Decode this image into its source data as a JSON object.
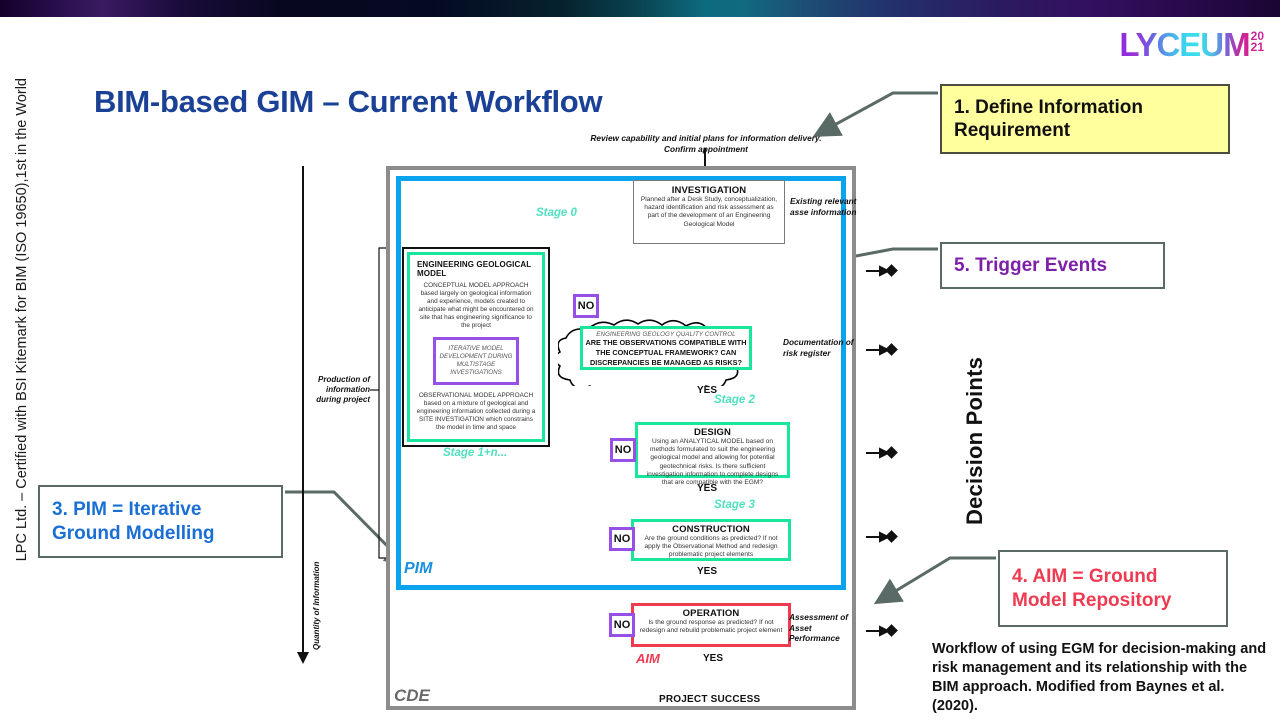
{
  "header": {
    "logo_word": "LYCEUM",
    "logo_year_top": "20",
    "logo_year_bottom": "21",
    "title": "BIM-based GIM – Current Workflow",
    "side_vertical_text": "LPC Ltd. – Certified with BSI Kitemark for BIM (ISO 19650),1st in the World"
  },
  "callouts": {
    "define": "1. Define Information Requirement",
    "trigger": "5. Trigger Events",
    "pim": "3. PIM = Iterative Ground Modelling",
    "aim": "4. AIM = Ground Model Repository"
  },
  "caption": "Workflow of using EGM for decision-making and risk management and its relationship with the BIM approach. Modified from Baynes et al. (2020).",
  "diagram": {
    "top_note": "Review capability and initial plans for information delivery.\nConfirm appointment",
    "frame_label_pim": "PIM",
    "frame_label_cde": "CDE",
    "frame_label_aim": "AIM",
    "nodes": {
      "investigation": {
        "heading": "INVESTIGATION",
        "body": "Planned after a Desk Study, conceptualization, hazard identification and risk assessment as part of the development of an Engineering Geological Model"
      },
      "egm": {
        "heading": "ENGINEERING GEOLOGICAL MODEL",
        "conceptual": "CONCEPTUAL MODEL APPROACH based largely on geological information and experience, models created to anticipate what might be encountered on site that has engineering significance to the project",
        "iterative": "ITERATIVE MODEL DEVELOPMENT DURING MULTISTAGE INVESTIGATIONS",
        "observational": "OBSERVATIONAL MODEL APPROACH based on a mixture of geological and engineering information collected during a SITE INVESTIGATION which constrains the model in time and space"
      },
      "quality_control": {
        "line1": "ENGINEERING GEOLOGY QUALITY CONTROL",
        "line2": "ARE THE OBSERVATIONS COMPATIBLE WITH THE CONCEPTUAL FRAMEWORK? CAN DISCREPANCIES BE MANAGED AS RISKS?"
      },
      "design": {
        "heading": "DESIGN",
        "body": "Using an ANALYTICAL MODEL based on methods formulated to suit the engineering geological model and allowing for potential geotechnical risks.  Is there sufficient investigation information to complete designs that are compatible with the EGM?"
      },
      "construction": {
        "heading": "CONSTRUCTION",
        "body": "Are the ground conditions as predicted? If not apply the Observational Method and redesign problematic project elements"
      },
      "operation": {
        "heading": "OPERATION",
        "body": "Is the ground response as predicted? If not redesign and rebuild problematic project element"
      }
    },
    "decision_chips": [
      "NO",
      "NO",
      "NO",
      "NO"
    ],
    "yes_labels": [
      "YES",
      "YES",
      "YES",
      "YES"
    ],
    "stages": [
      "Stage 0",
      "Stage 1+n...",
      "Stage 2",
      "Stage 3"
    ],
    "project_success": "PROJECT SUCCESS",
    "side_notes": {
      "existing_asset": "Existing relevant asse information",
      "risk_register": "Documentation of risk register",
      "asset_performance": "Assessment of Asset Performance"
    },
    "left_axis": {
      "production": "Production of information during project",
      "quantity": "Quantity of Information"
    },
    "right_axis": {
      "decision_points": "Decision Points",
      "marker_count": 5
    }
  },
  "colors": {
    "title_blue": "#1a4196",
    "callout_yellow": "#ffff9e",
    "trigger_purple": "#7d1fa8",
    "pim_blue": "#1a6fd4",
    "aim_red": "#ef3b52",
    "green_border": "#17e69b",
    "purple_border": "#9650e8",
    "cyan_frame": "#0aa3ee",
    "stage_teal": "#4fe0c0",
    "gray_frame": "#8c8c8c"
  }
}
